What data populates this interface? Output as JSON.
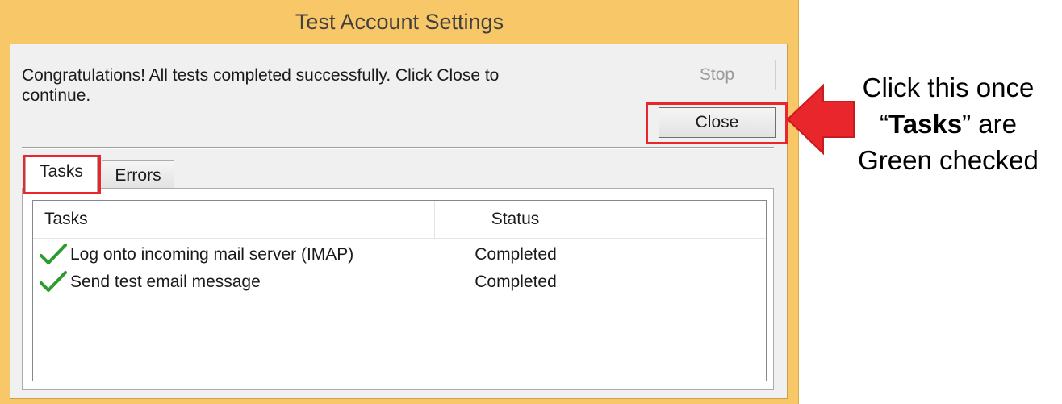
{
  "dialog": {
    "title": "Test Account Settings",
    "message": "Congratulations! All tests completed successfully. Click Close to continue.",
    "buttons": {
      "stop": "Stop",
      "close": "Close"
    },
    "tabs": [
      {
        "label": "Tasks",
        "selected": true
      },
      {
        "label": "Errors",
        "selected": false
      }
    ],
    "table": {
      "columns": [
        "Tasks",
        "Status"
      ],
      "rows": [
        {
          "icon": "green-check-icon",
          "task": "Log onto incoming mail server (IMAP)",
          "status": "Completed"
        },
        {
          "icon": "green-check-icon",
          "task": "Send test email message",
          "status": "Completed"
        }
      ]
    }
  },
  "annotation": {
    "line1": "Click this once",
    "quote_open": "“",
    "bold_word": "Tasks",
    "quote_close_suffix": "” are",
    "line3": "Green checked",
    "highlight_color": "#e8262b"
  },
  "colors": {
    "frame": "#f7c768",
    "check": "#2e9b2e",
    "arrow": "#e8262b"
  }
}
